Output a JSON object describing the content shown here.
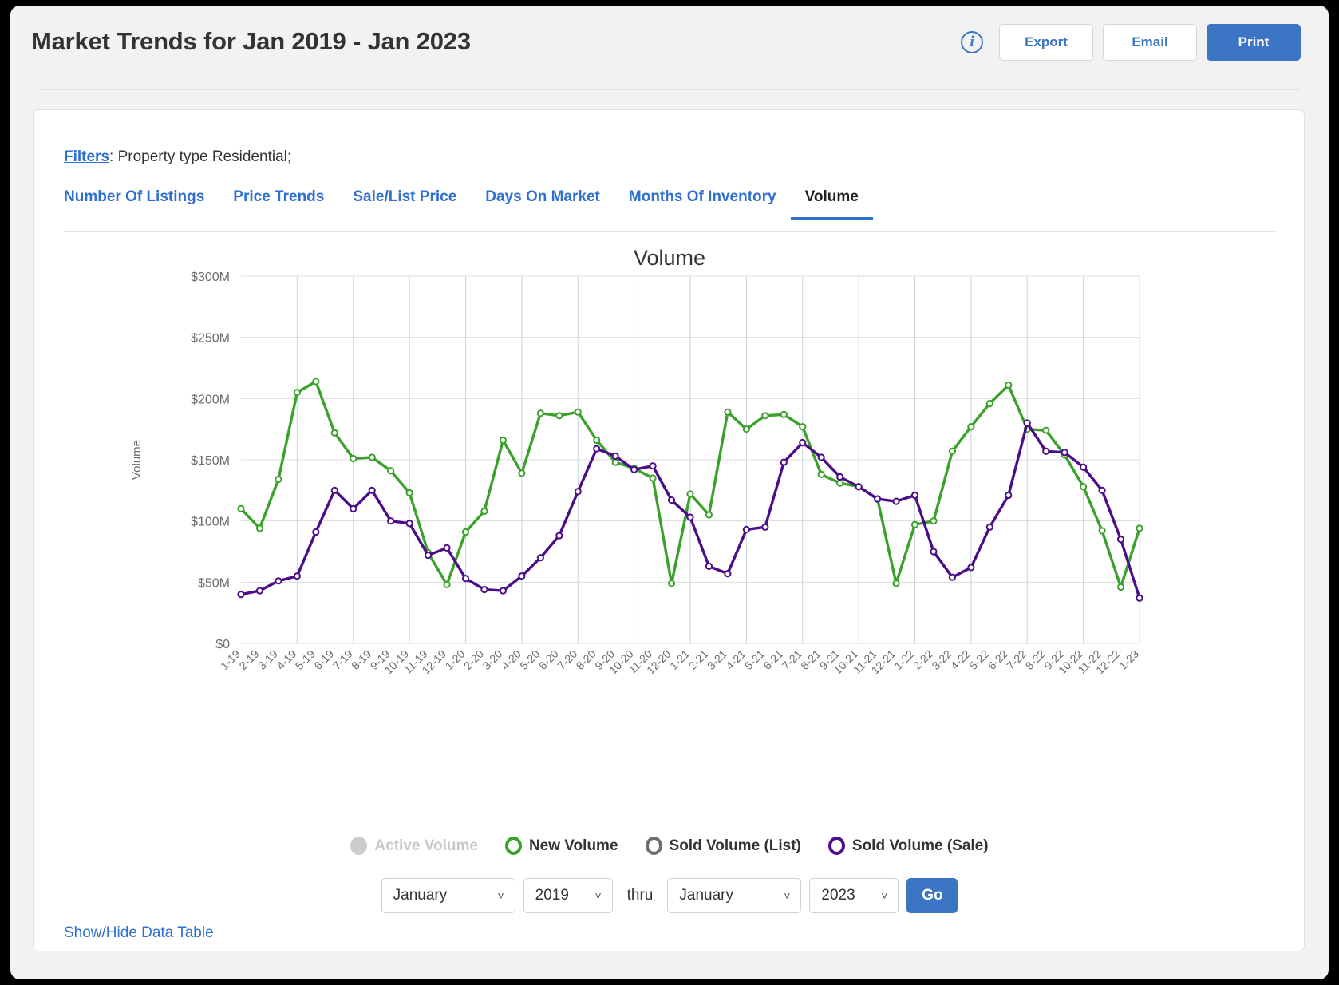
{
  "header": {
    "title": "Market Trends for Jan 2019 - Jan 2023",
    "info_icon": "info-icon",
    "export_label": "Export",
    "email_label": "Email",
    "print_label": "Print",
    "accent_blue": "#3b75c4"
  },
  "filters": {
    "link_label": "Filters",
    "text": ": Property type Residential;"
  },
  "tabs": [
    {
      "label": "Number Of Listings",
      "active": false
    },
    {
      "label": "Price Trends",
      "active": false
    },
    {
      "label": "Sale/List Price",
      "active": false
    },
    {
      "label": "Days On Market",
      "active": false
    },
    {
      "label": "Months Of Inventory",
      "active": false
    },
    {
      "label": "Volume",
      "active": true
    }
  ],
  "controls": {
    "from_month": "January",
    "from_year": "2019",
    "thru_label": "thru",
    "to_month": "January",
    "to_year": "2023",
    "go_label": "Go",
    "chevron_icon": "chevron-down-icon"
  },
  "footer": {
    "show_hide_label": "Show/Hide Data Table"
  },
  "chart_data": {
    "type": "line",
    "title": "Volume",
    "xlabel": "",
    "ylabel": "Volume",
    "ylim": [
      0,
      300
    ],
    "yticks": [
      "$0",
      "$50M",
      "$100M",
      "$150M",
      "$200M",
      "$250M",
      "$300M"
    ],
    "ytick_values": [
      0,
      50,
      100,
      150,
      200,
      250,
      300
    ],
    "unit": "millions of dollars",
    "grid": true,
    "legend_position": "bottom",
    "categories": [
      "1-19",
      "2-19",
      "3-19",
      "4-19",
      "5-19",
      "6-19",
      "7-19",
      "8-19",
      "9-19",
      "10-19",
      "11-19",
      "12-19",
      "1-20",
      "2-20",
      "3-20",
      "4-20",
      "5-20",
      "6-20",
      "7-20",
      "8-20",
      "9-20",
      "10-20",
      "11-20",
      "12-20",
      "1-21",
      "2-21",
      "3-21",
      "4-21",
      "5-21",
      "6-21",
      "7-21",
      "8-21",
      "9-21",
      "10-21",
      "11-21",
      "12-21",
      "1-22",
      "2-22",
      "3-22",
      "4-22",
      "5-22",
      "6-22",
      "7-22",
      "8-22",
      "9-22",
      "10-22",
      "11-22",
      "12-22",
      "1-23"
    ],
    "series": [
      {
        "name": "Active Volume",
        "color": "#cccccc",
        "visible": false,
        "values": []
      },
      {
        "name": "New Volume",
        "color": "#3aa22a",
        "visible": true,
        "values": [
          110,
          94,
          134,
          205,
          214,
          172,
          151,
          152,
          141,
          123,
          74,
          48,
          91,
          108,
          166,
          139,
          188,
          186,
          189,
          166,
          148,
          143,
          135,
          49,
          122,
          105,
          189,
          175,
          186,
          187,
          177,
          138,
          131,
          128,
          118,
          49,
          97,
          100,
          157,
          177,
          196,
          211,
          175,
          174,
          154,
          128,
          92,
          46,
          94
        ]
      },
      {
        "name": "Sold Volume (List)",
        "color": "#6e6e6e",
        "visible": false,
        "values": []
      },
      {
        "name": "Sold Volume (Sale)",
        "color": "#4b0d8a",
        "visible": true,
        "values": [
          40,
          43,
          51,
          55,
          91,
          125,
          110,
          125,
          100,
          98,
          72,
          78,
          53,
          44,
          43,
          55,
          70,
          88,
          124,
          159,
          153,
          142,
          145,
          117,
          103,
          63,
          57,
          93,
          95,
          148,
          164,
          152,
          136,
          128,
          118,
          116,
          121,
          75,
          54,
          62,
          95,
          121,
          180,
          157,
          156,
          144,
          125,
          85,
          37
        ]
      }
    ]
  }
}
